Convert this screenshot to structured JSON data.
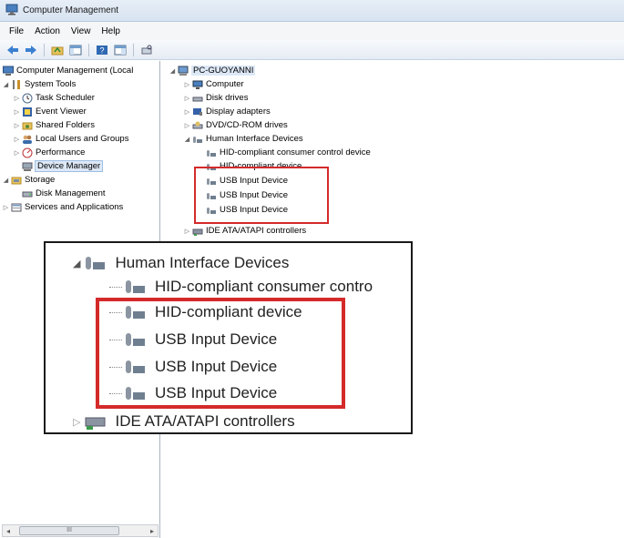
{
  "window": {
    "title": "Computer Management"
  },
  "menu": [
    "File",
    "Action",
    "View",
    "Help"
  ],
  "toolbar": {
    "buttons": [
      "back-icon",
      "forward-icon",
      "up-folder-icon",
      "properties-icon",
      "help-icon",
      "console-tree-icon",
      "scan-hardware-icon"
    ]
  },
  "left_tree": {
    "root": "Computer Management (Local",
    "system_tools": "System Tools",
    "task_scheduler": "Task Scheduler",
    "event_viewer": "Event Viewer",
    "shared_folders": "Shared Folders",
    "local_users": "Local Users and Groups",
    "performance": "Performance",
    "device_manager": "Device Manager",
    "storage": "Storage",
    "disk_management": "Disk Management",
    "services_apps": "Services and Applications"
  },
  "device_tree": {
    "pc": "PC-GUOYANNI",
    "computer": "Computer",
    "disk_drives": "Disk drives",
    "display_adapters": "Display adapters",
    "dvd": "DVD/CD-ROM drives",
    "hid": "Human Interface Devices",
    "hid_consumer": "HID-compliant consumer control device",
    "hid_device": "HID-compliant device",
    "usb1": "USB Input Device",
    "usb2": "USB Input Device",
    "usb3": "USB Input Device",
    "ide": "IDE ATA/ATAPI controllers"
  },
  "zoom": {
    "hid": "Human Interface Devices",
    "hid_consumer": "HID-compliant consumer contro",
    "hid_device": "HID-compliant device",
    "usb1": "USB Input Device",
    "usb2": "USB Input Device",
    "usb3": "USB Input Device",
    "ide": "IDE ATA/ATAPI controllers"
  },
  "scrollbar": {
    "thumb_glyph": "III"
  },
  "colors": {
    "highlight": "#d42a2a",
    "selection": "#dde8f6"
  }
}
